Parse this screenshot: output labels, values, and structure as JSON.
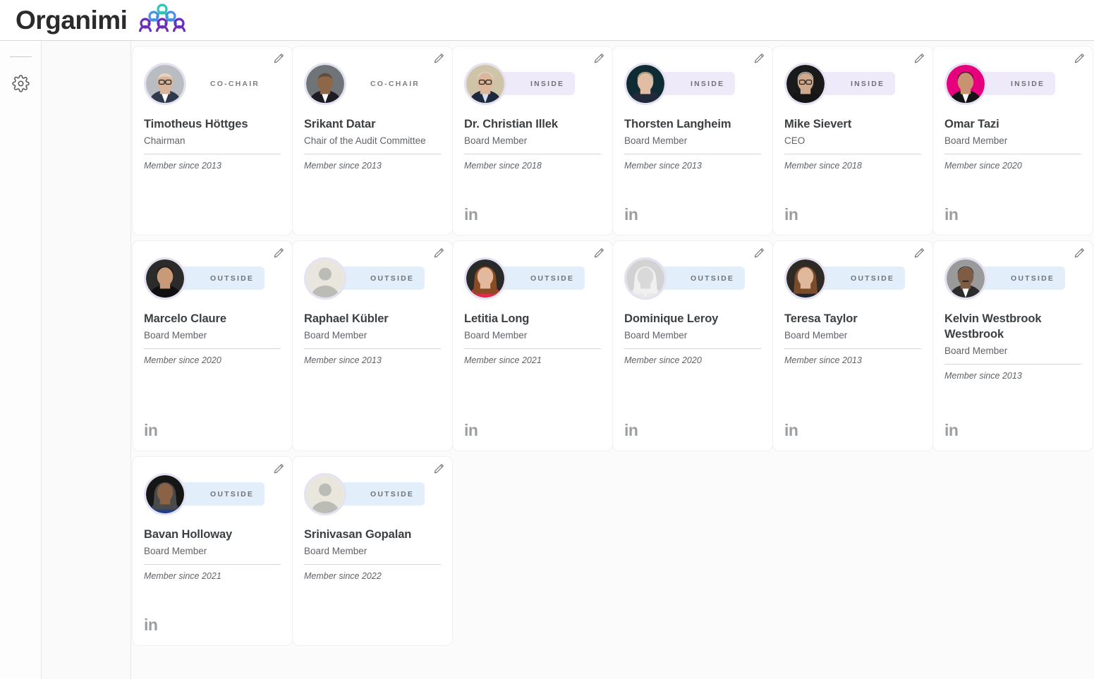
{
  "header": {
    "brand_name": "Organimi",
    "logo_icon": "organimi-pyramid-logo",
    "logo_colors": {
      "top": "#2ec4b6",
      "middle": "#4a90e2",
      "bottom": "#6b2fb5"
    }
  },
  "sidebar": {
    "divider": "rail-divider",
    "items": [
      {
        "icon": "gear-icon",
        "label": "Settings"
      }
    ]
  },
  "badges": {
    "co_chair": {
      "label": "CO-CHAIR",
      "color": "transparent"
    },
    "inside": {
      "label": "INSIDE",
      "color": "#eeeafa"
    },
    "outside": {
      "label": "OUTSIDE",
      "color": "#e2effb"
    }
  },
  "icons": {
    "edit": "pencil-icon",
    "linkedin": "in"
  },
  "members": [
    {
      "name": "Timotheus Höttges",
      "title": "Chairman",
      "since": "Member since 2013",
      "badge": "CO-CHAIR",
      "badge_type": "plain",
      "linkedin": false,
      "avatar": "photo",
      "photo": "tim"
    },
    {
      "name": "Srikant Datar",
      "title": "Chair of the Audit Committee",
      "since": "Member since 2013",
      "badge": "CO-CHAIR",
      "badge_type": "plain",
      "linkedin": false,
      "avatar": "photo",
      "photo": "srikant"
    },
    {
      "name": "Dr. Christian Illek",
      "title": "Board Member",
      "since": "Member since 2018",
      "badge": "INSIDE",
      "badge_type": "inside",
      "linkedin": true,
      "avatar": "photo",
      "photo": "christian"
    },
    {
      "name": "Thorsten Langheim",
      "title": "Board Member",
      "since": "Member since 2013",
      "badge": "INSIDE",
      "badge_type": "inside",
      "linkedin": true,
      "avatar": "photo",
      "photo": "thorsten"
    },
    {
      "name": "Mike Sievert",
      "title": "CEO",
      "since": "Member since 2018",
      "badge": "INSIDE",
      "badge_type": "inside",
      "linkedin": true,
      "avatar": "photo",
      "photo": "mike"
    },
    {
      "name": "Omar Tazi",
      "title": "Board Member",
      "since": "Member since 2020",
      "badge": "INSIDE",
      "badge_type": "inside",
      "linkedin": true,
      "avatar": "photo",
      "photo": "omar"
    },
    {
      "name": "Marcelo Claure",
      "title": "Board Member",
      "since": "Member since 2020",
      "badge": "OUTSIDE",
      "badge_type": "outside",
      "linkedin": true,
      "avatar": "photo",
      "photo": "marcelo"
    },
    {
      "name": "Raphael Kübler",
      "title": "Board Member",
      "since": "Member since 2013",
      "badge": "OUTSIDE",
      "badge_type": "outside",
      "linkedin": false,
      "avatar": "placeholder",
      "photo": ""
    },
    {
      "name": "Letitia Long",
      "title": "Board Member",
      "since": "Member since 2021",
      "badge": "OUTSIDE",
      "badge_type": "outside",
      "linkedin": true,
      "avatar": "photo",
      "photo": "letitia"
    },
    {
      "name": "Dominique Leroy",
      "title": "Board Member",
      "since": "Member since 2020",
      "badge": "OUTSIDE",
      "badge_type": "outside",
      "linkedin": true,
      "avatar": "photo",
      "photo": "dominique"
    },
    {
      "name": "Teresa Taylor",
      "title": "Board Member",
      "since": "Member since 2013",
      "badge": "OUTSIDE",
      "badge_type": "outside",
      "linkedin": true,
      "avatar": "photo",
      "photo": "teresa"
    },
    {
      "name": "Kelvin Westbrook Westbrook",
      "title": "Board Member",
      "since": "Member since 2013",
      "badge": "OUTSIDE",
      "badge_type": "outside",
      "linkedin": true,
      "avatar": "photo",
      "photo": "kelvin"
    },
    {
      "name": "Bavan Holloway",
      "title": "Board Member",
      "since": "Member since 2021",
      "badge": "OUTSIDE",
      "badge_type": "outside",
      "linkedin": true,
      "avatar": "photo",
      "photo": "bavan"
    },
    {
      "name": "Srinivasan Gopalan",
      "title": "Board Member",
      "since": "Member since 2022",
      "badge": "OUTSIDE",
      "badge_type": "outside",
      "linkedin": false,
      "avatar": "placeholder",
      "photo": ""
    }
  ]
}
